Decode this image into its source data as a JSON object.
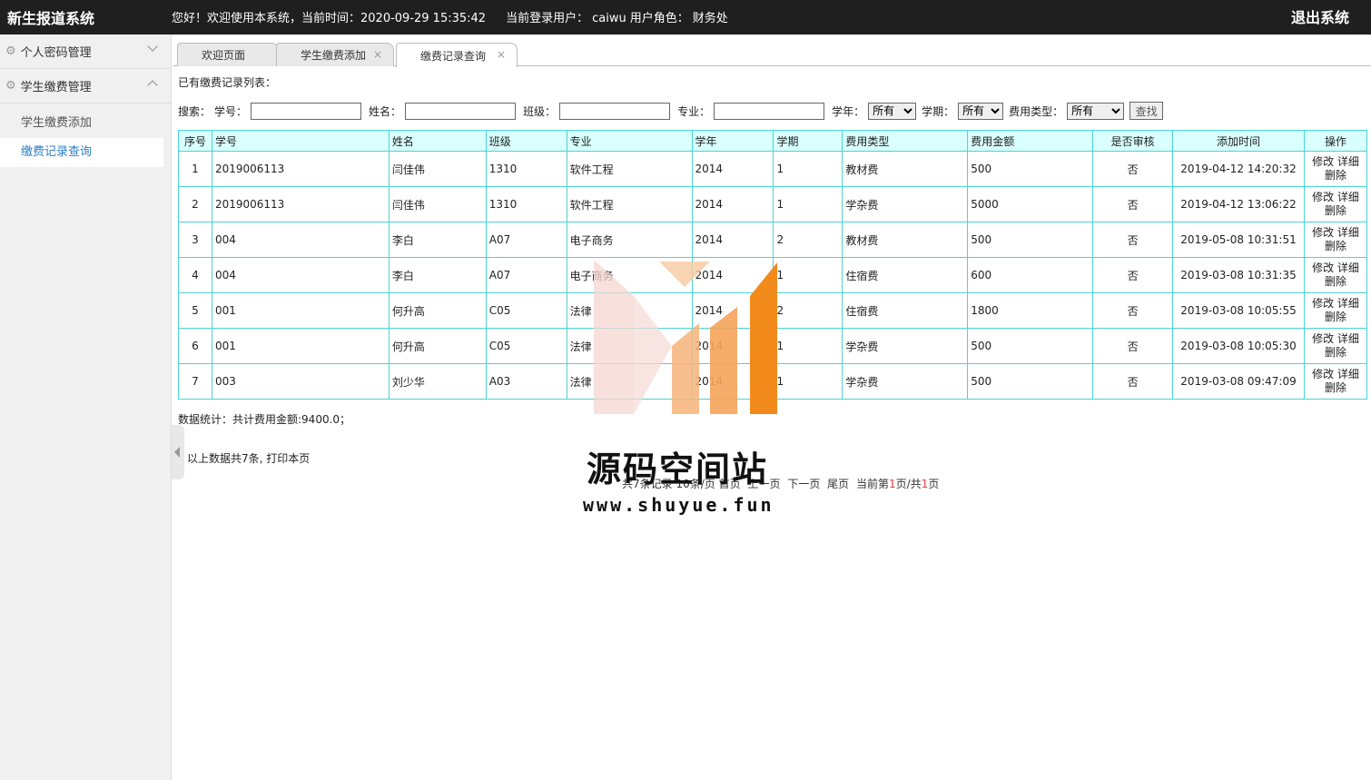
{
  "header": {
    "system_title": "新生报道系统",
    "welcome_text": "您好！欢迎使用本系统，当前时间：2020-09-29 15:35:42",
    "current_user_label": "当前登录用户：",
    "current_user": "caiwu",
    "role_label": "用户角色：",
    "role": "财务处",
    "logout_label": "退出系统"
  },
  "sidebar": {
    "groups": [
      {
        "label": "个人密码管理",
        "expanded": false
      },
      {
        "label": "学生缴费管理",
        "expanded": true
      }
    ],
    "sub_items": [
      {
        "label": "学生缴费添加"
      },
      {
        "label": "缴费记录查询"
      }
    ]
  },
  "tabs": [
    {
      "label": "欢迎页面"
    },
    {
      "label": "学生缴费添加",
      "close": "×"
    },
    {
      "label": "缴费记录查询",
      "close": "×"
    }
  ],
  "content": {
    "list_title": "已有缴费记录列表：",
    "search": {
      "search_label": "搜索：",
      "student_no_label": "学号：",
      "name_label": "姓名：",
      "class_label": "班级：",
      "major_label": "专业：",
      "year_label": "学年：",
      "year_value": "所有",
      "term_label": "学期：",
      "term_value": "所有",
      "fee_type_label": "费用类型：",
      "fee_type_value": "所有",
      "search_button": "查找"
    },
    "table": {
      "headers": [
        "序号",
        "学号",
        "姓名",
        "班级",
        "专业",
        "学年",
        "学期",
        "费用类型",
        "费用金额",
        "是否审核",
        "添加时间",
        "操作"
      ],
      "rows": [
        [
          "1",
          "2019006113",
          "闫佳伟",
          "1310",
          "软件工程",
          "2014",
          "1",
          "教材费",
          "500",
          "否",
          "2019-04-12 14:20:32"
        ],
        [
          "2",
          "2019006113",
          "闫佳伟",
          "1310",
          "软件工程",
          "2014",
          "1",
          "学杂费",
          "5000",
          "否",
          "2019-04-12 13:06:22"
        ],
        [
          "3",
          "004",
          "李白",
          "A07",
          "电子商务",
          "2014",
          "2",
          "教材费",
          "500",
          "否",
          "2019-05-08 10:31:51"
        ],
        [
          "4",
          "004",
          "李白",
          "A07",
          "电子商务",
          "2014",
          "1",
          "住宿费",
          "600",
          "否",
          "2019-03-08 10:31:35"
        ],
        [
          "5",
          "001",
          "何升高",
          "C05",
          "法律",
          "2014",
          "2",
          "住宿费",
          "1800",
          "否",
          "2019-03-08 10:05:55"
        ],
        [
          "6",
          "001",
          "何升高",
          "C05",
          "法律",
          "2014",
          "1",
          "学杂费",
          "500",
          "否",
          "2019-03-08 10:05:30"
        ],
        [
          "7",
          "003",
          "刘少华",
          "A03",
          "法律",
          "2014",
          "1",
          "学杂费",
          "500",
          "否",
          "2019-03-08 09:47:09"
        ]
      ],
      "ops": {
        "edit": "修改",
        "detail": "详细",
        "delete": "删除"
      }
    },
    "stats": "数据统计：共计费用金额:9400.0；",
    "print_line": {
      "prefix": "以上数据共7条,",
      "link": "打印本页"
    },
    "pager": {
      "total": "共7条记录",
      "per_page": "10条/页",
      "first": "首页",
      "prev": "上一页",
      "next": "下一页",
      "last": "尾页",
      "current_prefix": "当前第",
      "current_page": "1",
      "mid": "页/共",
      "total_pages": "1",
      "suffix": "页"
    }
  },
  "watermark": {
    "text": "源码空间站",
    "url": "www.shuyue.fun",
    "colors": [
      "#f5d5d0",
      "#f7c9a0",
      "#f5a35a",
      "#f28a1c"
    ]
  }
}
